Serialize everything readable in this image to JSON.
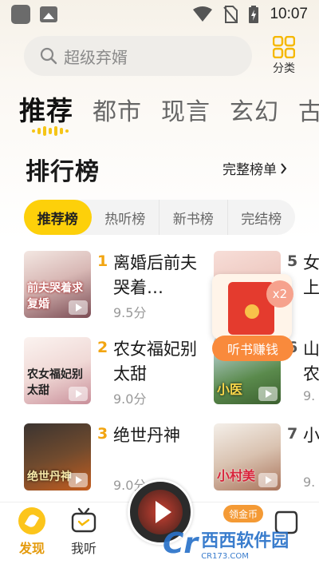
{
  "status_bar": {
    "time": "10:07"
  },
  "search": {
    "placeholder": "超级弃婿"
  },
  "category": {
    "label": "分类"
  },
  "tabs": [
    {
      "label": "推荐"
    },
    {
      "label": "都市"
    },
    {
      "label": "现言"
    },
    {
      "label": "玄幻"
    },
    {
      "label": "古言"
    }
  ],
  "ranking": {
    "title": "排行榜",
    "more_label": "完整榜单",
    "subtabs": [
      {
        "label": "推荐榜"
      },
      {
        "label": "热听榜"
      },
      {
        "label": "新书榜"
      },
      {
        "label": "完结榜"
      }
    ]
  },
  "books": [
    {
      "rank": "1",
      "name": "离婚后前夫哭着…",
      "score": "9.5分",
      "cover_text": "前夫哭着求复婚",
      "color": "#f2a511"
    },
    {
      "rank": "2",
      "name": "农女福妃别太甜",
      "score": "9.0分",
      "cover_text": "农女福妃别太甜",
      "color": "#f2a511"
    },
    {
      "rank": "3",
      "name": "绝世丹神",
      "score": "9.0分",
      "cover_text": "绝世丹神",
      "color": "#f2a511"
    },
    {
      "rank": "5",
      "name": "女上",
      "score": "",
      "cover_text": ""
    },
    {
      "rank": "6",
      "name": "山农",
      "score": "9.",
      "cover_text": "小医"
    },
    {
      "rank": "7",
      "name": "小",
      "score": "9.",
      "cover_text": "小村美"
    }
  ],
  "overlays": {
    "x2_label": "x2",
    "earn_label": "听书赚钱",
    "gold_badge": "领金币"
  },
  "bottom_nav": {
    "discover": "发现",
    "listen": "我听"
  },
  "watermark": {
    "logo": "Cr",
    "title": "西西软件园",
    "url": "CR173.COM"
  }
}
